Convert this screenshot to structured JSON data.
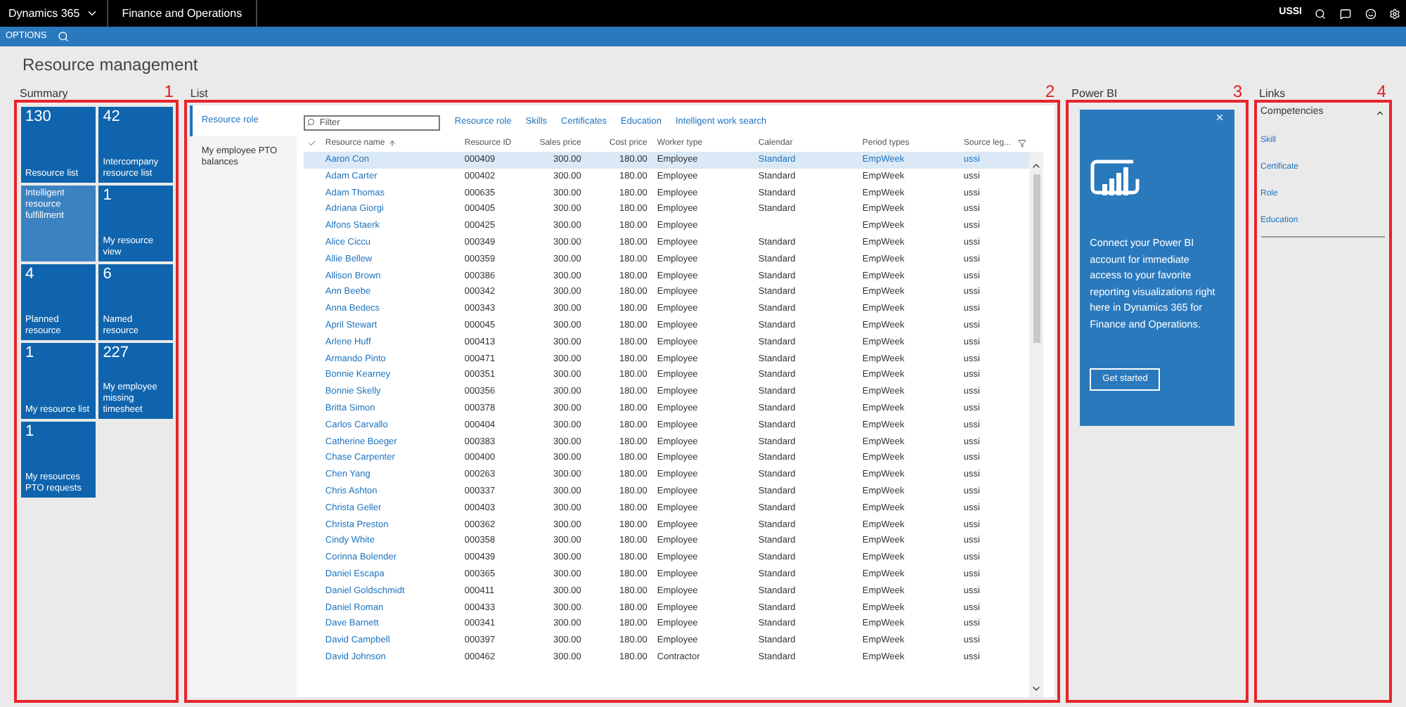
{
  "top_bar": {
    "product": "Dynamics 365",
    "module": "Finance and Operations",
    "company": "USSI"
  },
  "action_bar": {
    "label": "OPTIONS"
  },
  "page_title": "Resource management",
  "summary": {
    "heading": "Summary",
    "annotation": "1",
    "tiles": [
      {
        "count": "130",
        "label": "Resource list",
        "highlighted": false
      },
      {
        "count": "42",
        "label": "Intercompany resource list",
        "highlighted": false
      },
      {
        "label": "Intelligent resource fulfillment",
        "highlighted": true
      },
      {
        "count": "1",
        "label": "My resource view",
        "highlighted": false
      },
      {
        "count": "4",
        "label": "Planned resource",
        "highlighted": false
      },
      {
        "count": "6",
        "label": "Named resource",
        "highlighted": false
      },
      {
        "count": "1",
        "label": "My resource list",
        "highlighted": false
      },
      {
        "count": "227",
        "label": "My employee missing timesheet",
        "highlighted": false
      },
      {
        "count": "1",
        "label": "My resources PTO requests",
        "highlighted": false
      }
    ]
  },
  "list": {
    "heading": "List",
    "annotation": "2",
    "tabs": [
      {
        "label": "Resource role",
        "selected": true
      },
      {
        "label": "My employee PTO balances",
        "selected": false
      }
    ],
    "filter": {
      "placeholder": "Filter"
    },
    "actions": [
      "Resource role",
      "Skills",
      "Certificates",
      "Education",
      "Intelligent work search"
    ],
    "columns": [
      "Resource name",
      "Resource ID",
      "Sales price",
      "Cost price",
      "Worker type",
      "Calendar",
      "Period types",
      "Source leg..."
    ],
    "rows": [
      {
        "selected": true,
        "cells": [
          "Aaron Con",
          "000409",
          "300.00",
          "180.00",
          "Employee",
          "Standard",
          "EmpWeek",
          "ussi"
        ]
      },
      {
        "selected": false,
        "cells": [
          "Adam Carter",
          "000402",
          "300.00",
          "180.00",
          "Employee",
          "Standard",
          "EmpWeek",
          "ussi"
        ]
      },
      {
        "selected": false,
        "cells": [
          "Adam Thomas",
          "000635",
          "300.00",
          "180.00",
          "Employee",
          "Standard",
          "EmpWeek",
          "ussi"
        ]
      },
      {
        "selected": false,
        "cells": [
          "Adriana Giorgi",
          "000405",
          "300.00",
          "180.00",
          "Employee",
          "Standard",
          "EmpWeek",
          "ussi"
        ]
      },
      {
        "selected": false,
        "cells": [
          "Alfons Staerk",
          "000425",
          "300.00",
          "180.00",
          "Employee",
          null,
          "EmpWeek",
          "ussi"
        ]
      },
      {
        "selected": false,
        "cells": [
          "Alice Ciccu",
          "000349",
          "300.00",
          "180.00",
          "Employee",
          "Standard",
          "EmpWeek",
          "ussi"
        ]
      },
      {
        "selected": false,
        "cells": [
          "Allie Bellew",
          "000359",
          "300.00",
          "180.00",
          "Employee",
          "Standard",
          "EmpWeek",
          "ussi"
        ]
      },
      {
        "selected": false,
        "cells": [
          "Allison Brown",
          "000386",
          "300.00",
          "180.00",
          "Employee",
          "Standard",
          "EmpWeek",
          "ussi"
        ]
      },
      {
        "selected": false,
        "cells": [
          "Ann Beebe",
          "000342",
          "300.00",
          "180.00",
          "Employee",
          "Standard",
          "EmpWeek",
          "ussi"
        ]
      },
      {
        "selected": false,
        "cells": [
          "Anna Bedecs",
          "000343",
          "300.00",
          "180.00",
          "Employee",
          "Standard",
          "EmpWeek",
          "ussi"
        ]
      },
      {
        "selected": false,
        "cells": [
          "April Stewart",
          "000045",
          "300.00",
          "180.00",
          "Employee",
          "Standard",
          "EmpWeek",
          "ussi"
        ]
      },
      {
        "selected": false,
        "cells": [
          "Arlene Huff",
          "000413",
          "300.00",
          "180.00",
          "Employee",
          "Standard",
          "EmpWeek",
          "ussi"
        ]
      },
      {
        "selected": false,
        "cells": [
          "Armando Pinto",
          "000471",
          "300.00",
          "180.00",
          "Employee",
          "Standard",
          "EmpWeek",
          "ussi"
        ]
      },
      {
        "selected": false,
        "cells": [
          "Bonnie Kearney",
          "000351",
          "300.00",
          "180.00",
          "Employee",
          "Standard",
          "EmpWeek",
          "ussi"
        ]
      },
      {
        "selected": false,
        "cells": [
          "Bonnie Skelly",
          "000356",
          "300.00",
          "180.00",
          "Employee",
          "Standard",
          "EmpWeek",
          "ussi"
        ]
      },
      {
        "selected": false,
        "cells": [
          "Britta Simon",
          "000378",
          "300.00",
          "180.00",
          "Employee",
          "Standard",
          "EmpWeek",
          "ussi"
        ]
      },
      {
        "selected": false,
        "cells": [
          "Carlos Carvallo",
          "000404",
          "300.00",
          "180.00",
          "Employee",
          "Standard",
          "EmpWeek",
          "ussi"
        ]
      },
      {
        "selected": false,
        "cells": [
          "Catherine Boeger",
          "000383",
          "300.00",
          "180.00",
          "Employee",
          "Standard",
          "EmpWeek",
          "ussi"
        ]
      },
      {
        "selected": false,
        "cells": [
          "Chase Carpenter",
          "000400",
          "300.00",
          "180.00",
          "Employee",
          "Standard",
          "EmpWeek",
          "ussi"
        ]
      },
      {
        "selected": false,
        "cells": [
          "Chen Yang",
          "000263",
          "300.00",
          "180.00",
          "Employee",
          "Standard",
          "EmpWeek",
          "ussi"
        ]
      },
      {
        "selected": false,
        "cells": [
          "Chris Ashton",
          "000337",
          "300.00",
          "180.00",
          "Employee",
          "Standard",
          "EmpWeek",
          "ussi"
        ]
      },
      {
        "selected": false,
        "cells": [
          "Christa Geller",
          "000403",
          "300.00",
          "180.00",
          "Employee",
          "Standard",
          "EmpWeek",
          "ussi"
        ]
      },
      {
        "selected": false,
        "cells": [
          "Christa Preston",
          "000362",
          "300.00",
          "180.00",
          "Employee",
          "Standard",
          "EmpWeek",
          "ussi"
        ]
      },
      {
        "selected": false,
        "cells": [
          "Cindy White",
          "000358",
          "300.00",
          "180.00",
          "Employee",
          "Standard",
          "EmpWeek",
          "ussi"
        ]
      },
      {
        "selected": false,
        "cells": [
          "Corinna Bolender",
          "000439",
          "300.00",
          "180.00",
          "Employee",
          "Standard",
          "EmpWeek",
          "ussi"
        ]
      },
      {
        "selected": false,
        "cells": [
          "Daniel Escapa",
          "000365",
          "300.00",
          "180.00",
          "Employee",
          "Standard",
          "EmpWeek",
          "ussi"
        ]
      },
      {
        "selected": false,
        "cells": [
          "Daniel Goldschmidt",
          "000411",
          "300.00",
          "180.00",
          "Employee",
          "Standard",
          "EmpWeek",
          "ussi"
        ]
      },
      {
        "selected": false,
        "cells": [
          "Daniel Roman",
          "000433",
          "300.00",
          "180.00",
          "Employee",
          "Standard",
          "EmpWeek",
          "ussi"
        ]
      },
      {
        "selected": false,
        "cells": [
          "Dave Barnett",
          "000341",
          "300.00",
          "180.00",
          "Employee",
          "Standard",
          "EmpWeek",
          "ussi"
        ]
      },
      {
        "selected": false,
        "cells": [
          "David Campbell",
          "000397",
          "300.00",
          "180.00",
          "Employee",
          "Standard",
          "EmpWeek",
          "ussi"
        ]
      },
      {
        "selected": false,
        "cells": [
          "David Johnson",
          "000462",
          "300.00",
          "180.00",
          "Contractor",
          "Standard",
          "EmpWeek",
          "ussi"
        ]
      }
    ]
  },
  "power_bi": {
    "heading": "Power BI",
    "annotation": "3",
    "message": "Connect your Power BI account for immediate access to your favorite reporting visualizations right here in Dynamics 365 for Finance and Operations.",
    "button": "Get started"
  },
  "links": {
    "heading": "Links",
    "annotation": "4",
    "group": "Competencies",
    "expanded": true,
    "items": [
      "Skill",
      "Certificate",
      "Role",
      "Education"
    ]
  }
}
